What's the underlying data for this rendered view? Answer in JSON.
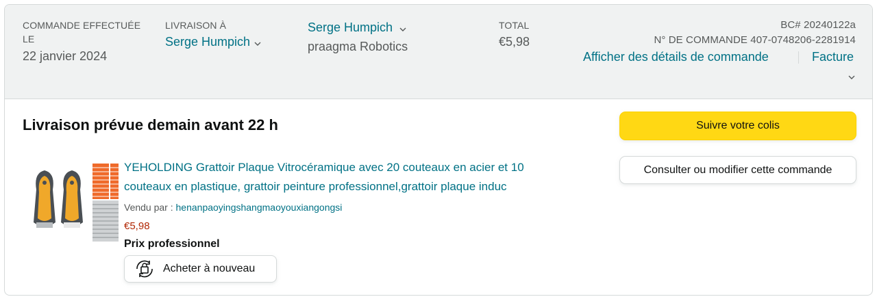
{
  "header": {
    "order_placed_label_line1": "COMMANDE EFFECTUÉE",
    "order_placed_label_line2": "LE",
    "order_placed_date": "22 janvier 2024",
    "ship_to_label": "LIVRAISON À",
    "ship_to_name": "Serge Humpich",
    "buyer_name": "Serge Humpich",
    "buyer_company": "praagma Robotics",
    "total_label": "TOTAL",
    "total_value": "€5,98",
    "po_number": "BC# 20240122a",
    "order_number": "N° DE COMMANDE 407-0748206-2281914",
    "details_link": "Afficher des détails de commande",
    "invoice_link": "Facture"
  },
  "shipment": {
    "title": "Livraison prévue demain avant 22 h",
    "track_button": "Suivre votre colis",
    "modify_button": "Consulter ou modifier cette commande"
  },
  "item": {
    "title": "YEHOLDING Grattoir Plaque Vitrocéramique avec 20 couteaux en acier et 10 couteaux en plastique, grattoir peinture professionnel,grattoir plaque induc",
    "sold_by_label": "Vendu par :",
    "seller": "henanpaoyingshangmaoyouxiangongsi",
    "price": "€5,98",
    "business_price": "Prix professionnel",
    "buy_again": "Acheter à nouveau"
  },
  "colors": {
    "link": "#007185",
    "price": "#b12704",
    "button_yellow": "#ffd814",
    "header_bg": "#f0f2f2"
  },
  "icons": [
    "chevron-down-icon",
    "buy-again-icon"
  ]
}
